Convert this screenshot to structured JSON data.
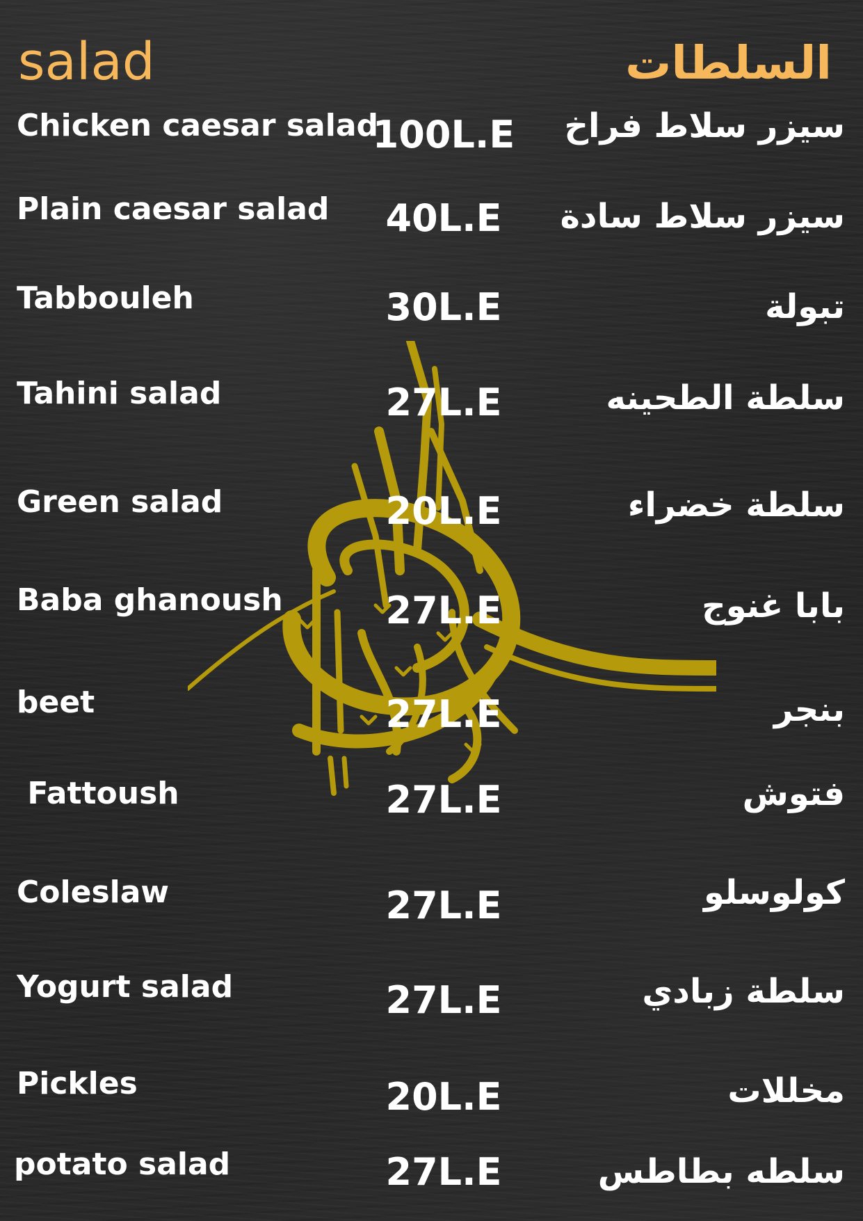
{
  "colors": {
    "title": "#f7b85c",
    "seal": "#b59a0c",
    "text": "#ffffff",
    "background": "#262626"
  },
  "header": {
    "title_en": "salad",
    "title_ar": "السلطات"
  },
  "items": [
    {
      "name_en": "Chicken caesar salad",
      "price": "100L.E",
      "name_ar": "سيزر سلاط فراخ"
    },
    {
      "name_en": "Plain caesar salad",
      "price": "40L.E",
      "name_ar": "سيزر سلاط سادة"
    },
    {
      "name_en": "Tabbouleh",
      "price": "30L.E",
      "name_ar": "تبولة"
    },
    {
      "name_en": "Tahini salad",
      "price": "27L.E",
      "name_ar": "سلطة الطحينه"
    },
    {
      "name_en": "Green salad",
      "price": "20L.E",
      "name_ar": "سلطة خضراء"
    },
    {
      "name_en": "Baba ghanoush",
      "price": "27L.E",
      "name_ar": "بابا غنوج"
    },
    {
      "name_en": "beet",
      "price": "27L.E",
      "name_ar": "بنجر"
    },
    {
      "name_en": " Fattoush",
      "price": "27L.E",
      "name_ar": "فتوش"
    },
    {
      "name_en": "Coleslaw",
      "price": "27L.E",
      "name_ar": "كولوسلو"
    },
    {
      "name_en": "Yogurt salad",
      "price": "27L.E",
      "name_ar": "سلطة زبادي"
    },
    {
      "name_en": "Pickles",
      "price": "20L.E",
      "name_ar": "مخللات"
    },
    {
      "name_en": "potato salad",
      "price": "27L.E",
      "name_ar": "سلطه بطاطس"
    }
  ]
}
